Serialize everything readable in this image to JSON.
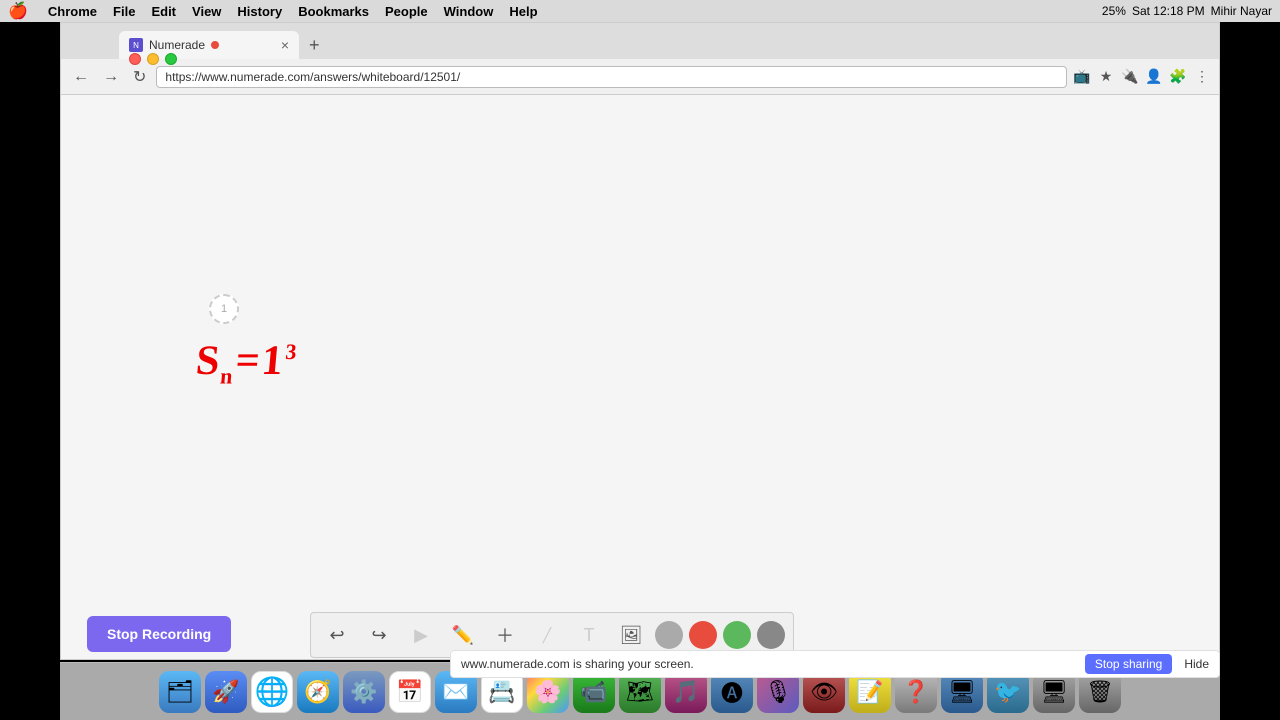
{
  "menubar": {
    "apple": "🍎",
    "items": [
      "Chrome",
      "File",
      "Edit",
      "View",
      "History",
      "Bookmarks",
      "People",
      "Window",
      "Help"
    ],
    "right": {
      "time": "Sat 12:18 PM",
      "user": "Mihir Nayar",
      "battery": "25%"
    }
  },
  "browser": {
    "tab": {
      "favicon": "N",
      "title": "Numerade",
      "recording_dot": true
    },
    "url": "https://www.numerade.com/answers/whiteboard/12501/",
    "page_number": "1"
  },
  "whiteboard": {
    "math_expression": "Sₙ=1³"
  },
  "toolbar": {
    "buttons": [
      "undo",
      "redo",
      "play",
      "pen",
      "plus",
      "eraser",
      "text",
      "image"
    ],
    "colors": [
      "gray",
      "red",
      "green",
      "darkgray"
    ]
  },
  "stop_recording": {
    "label": "Stop Recording"
  },
  "share_banner": {
    "message": "www.numerade.com is sharing your screen.",
    "stop_label": "Stop sharing",
    "hide_label": "Hide"
  },
  "dock": {
    "icons": [
      "finder",
      "launchpad",
      "chrome",
      "safari",
      "system-preferences",
      "calendar",
      "mail",
      "photos",
      "facetime",
      "contacts",
      "maps",
      "itunes",
      "appstore",
      "siri",
      "preview",
      "notes",
      "help",
      "mission-control",
      "twitter",
      "imac",
      "trash"
    ]
  }
}
